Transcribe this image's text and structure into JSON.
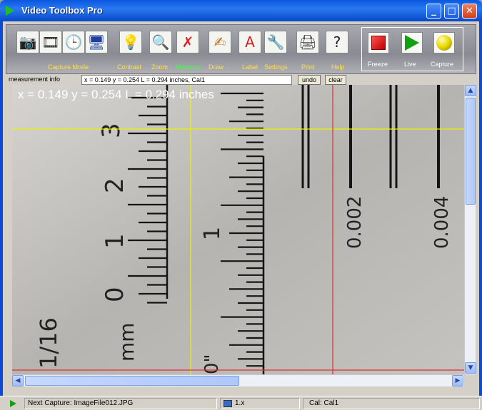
{
  "window": {
    "title": "Video Toolbox Pro"
  },
  "title_buttons": {
    "minimize": "_",
    "maximize": "□",
    "close": "✕"
  },
  "toolbar": {
    "tools": [
      {
        "name": "camera-icon",
        "glyph": "📷"
      },
      {
        "name": "film-icon",
        "glyph": "🎞"
      },
      {
        "name": "clock-icon",
        "glyph": "🕒"
      },
      {
        "name": "monitor-icon",
        "glyph": "🖥"
      },
      {
        "name": "lightbulb-icon",
        "glyph": "💡"
      },
      {
        "name": "magnifier-icon",
        "glyph": "🔍"
      },
      {
        "name": "measure-icon",
        "glyph": "✗"
      },
      {
        "name": "draw-icon",
        "glyph": "✍"
      },
      {
        "name": "label-icon",
        "glyph": "A"
      },
      {
        "name": "settings-icon",
        "glyph": "🔧"
      },
      {
        "name": "print-icon",
        "glyph": "🖨"
      },
      {
        "name": "help-icon",
        "glyph": "?"
      }
    ],
    "labels": {
      "capture_mode": "Capture Mode",
      "contrast": "Contrast",
      "zoom": "Zoom",
      "measure": "Measure",
      "draw": "Draw",
      "label": "Label",
      "settings": "Settings",
      "print": "Print",
      "help": "Help"
    },
    "controls": {
      "freeze": "Freeze",
      "live": "Live",
      "capture": "Capture"
    }
  },
  "measurement": {
    "label": "measurement info",
    "value": "x = 0.149 y = 0.254 L = 0.294 inches, Cal1",
    "undo": "undo",
    "clear": "clear"
  },
  "viewport": {
    "overlay_text": "x = 0.149 y = 0.254 L = 0.294 inches",
    "ruler_numbers": [
      "3",
      "2",
      "1",
      "0",
      "1"
    ],
    "ruler_units": [
      "mm",
      "1/16",
      "0\""
    ],
    "scale_labels": [
      "0.002",
      "0.004"
    ]
  },
  "statusbar": {
    "next_capture": "Next Capture: ImageFile012.JPG",
    "zoom": "1.x",
    "calibration": "Cal: Cal1"
  },
  "colors": {
    "title_blue": "#0a58e0",
    "crosshair_yellow": "#f0f000",
    "crosshair_red": "#e03030",
    "label_yellow": "#ffe040",
    "label_active_green": "#40ff40"
  }
}
